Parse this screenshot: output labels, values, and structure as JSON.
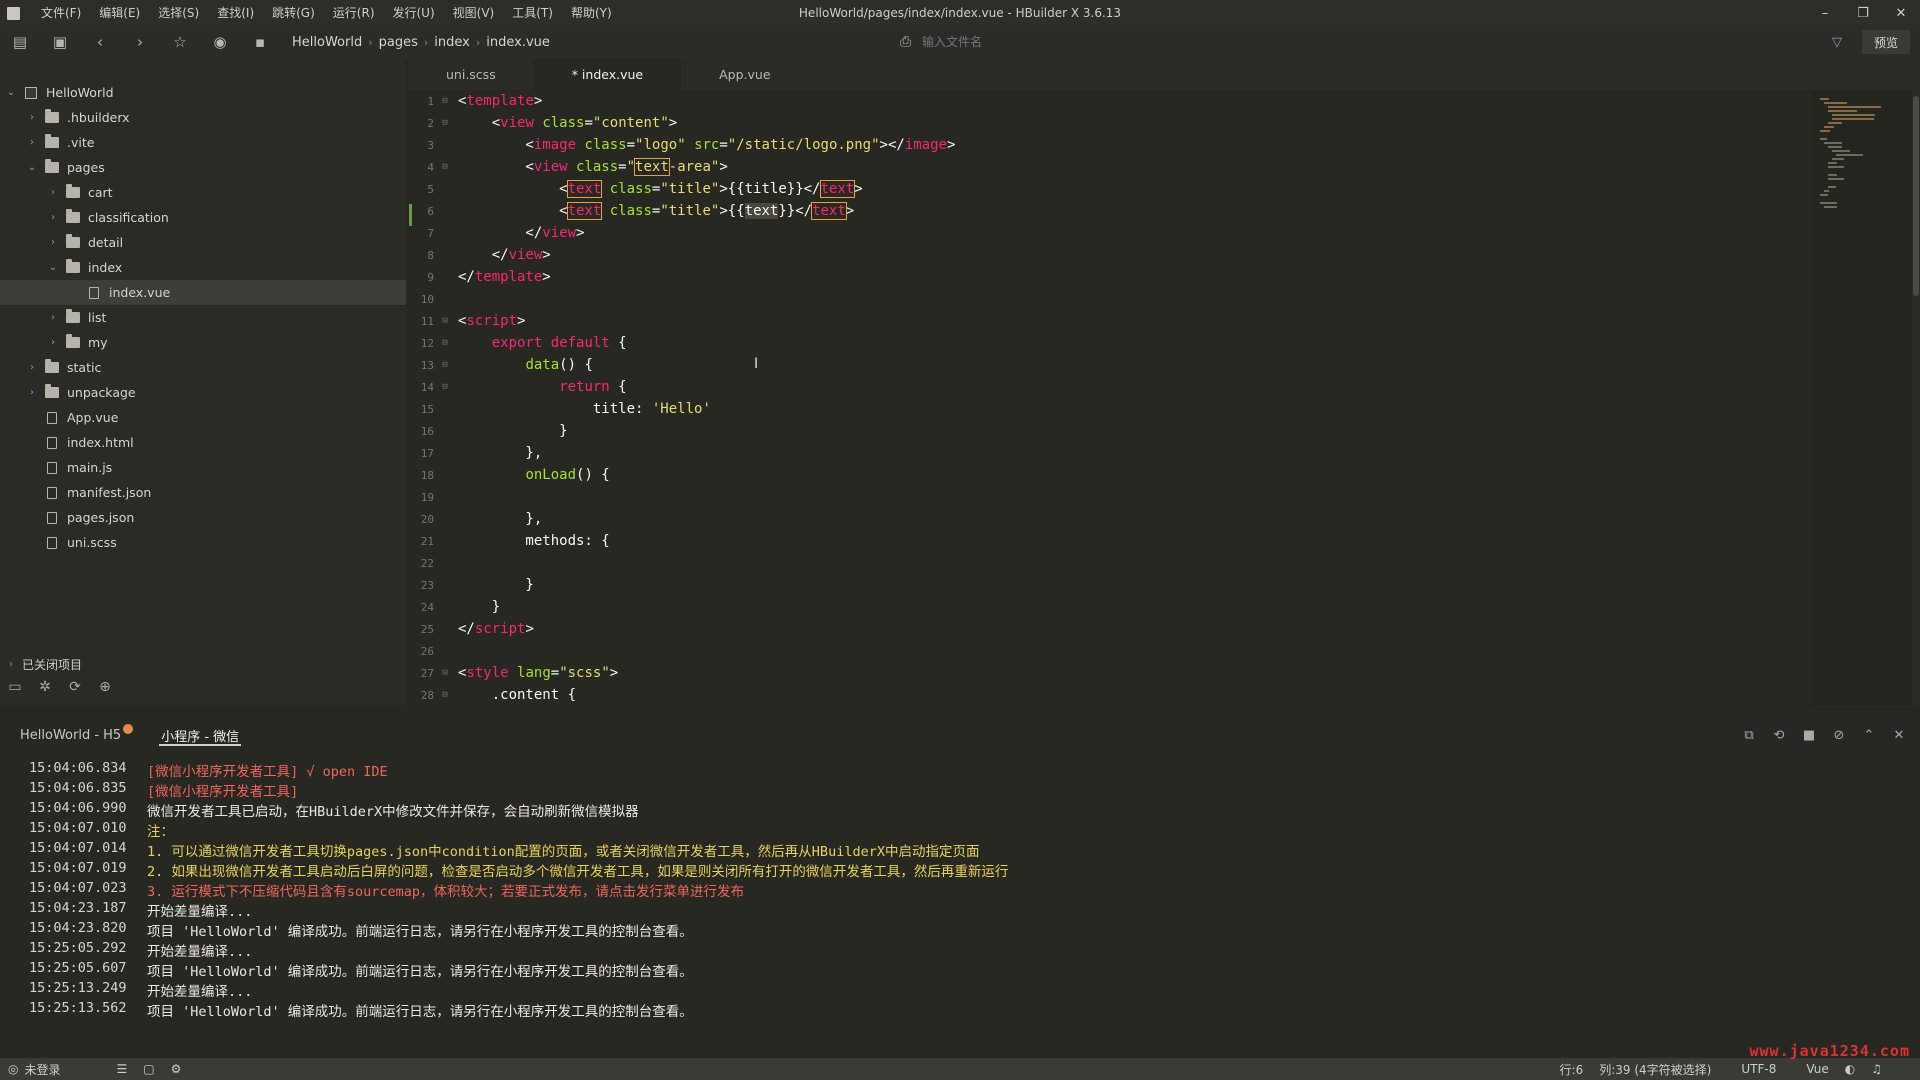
{
  "window": {
    "title": "HelloWorld/pages/index/index.vue - HBuilder X 3.6.13",
    "menus": [
      "文件(F)",
      "编辑(E)",
      "选择(S)",
      "查找(I)",
      "跳转(G)",
      "运行(R)",
      "发行(U)",
      "视图(V)",
      "工具(T)",
      "帮助(Y)"
    ],
    "controls": {
      "minimize": "–",
      "maximize": "❐",
      "close": "✕"
    }
  },
  "toolbar": {
    "breadcrumb": [
      "HelloWorld",
      "pages",
      "index",
      "index.vue"
    ],
    "file_input_placeholder": "输入文件名",
    "preview_label": "预览"
  },
  "sidebar": {
    "tree": [
      {
        "label": "HelloWorld",
        "type": "project",
        "depth": 0,
        "open": true
      },
      {
        "label": ".hbuilderx",
        "type": "folder",
        "depth": 1,
        "open": false
      },
      {
        "label": ".vite",
        "type": "folder",
        "depth": 1,
        "open": false
      },
      {
        "label": "pages",
        "type": "folder",
        "depth": 1,
        "open": true
      },
      {
        "label": "cart",
        "type": "folder",
        "depth": 2,
        "open": false
      },
      {
        "label": "classification",
        "type": "folder",
        "depth": 2,
        "open": false
      },
      {
        "label": "detail",
        "type": "folder",
        "depth": 2,
        "open": false
      },
      {
        "label": "index",
        "type": "folder",
        "depth": 2,
        "open": true
      },
      {
        "label": "index.vue",
        "type": "file",
        "depth": 3,
        "selected": true
      },
      {
        "label": "list",
        "type": "folder",
        "depth": 2,
        "open": false
      },
      {
        "label": "my",
        "type": "folder",
        "depth": 2,
        "open": false
      },
      {
        "label": "static",
        "type": "folder",
        "depth": 1,
        "open": false
      },
      {
        "label": "unpackage",
        "type": "folder",
        "depth": 1,
        "open": false
      },
      {
        "label": "App.vue",
        "type": "file",
        "depth": 1
      },
      {
        "label": "index.html",
        "type": "file",
        "depth": 1
      },
      {
        "label": "main.js",
        "type": "file",
        "depth": 1
      },
      {
        "label": "manifest.json",
        "type": "file",
        "depth": 1
      },
      {
        "label": "pages.json",
        "type": "file",
        "depth": 1
      },
      {
        "label": "uni.scss",
        "type": "file",
        "depth": 1
      }
    ],
    "closed_projects_label": "已关闭项目"
  },
  "tabs": [
    {
      "label": "uni.scss",
      "active": false
    },
    {
      "label": "* index.vue",
      "active": true
    },
    {
      "label": "App.vue",
      "active": false
    }
  ],
  "editor": {
    "lines": [
      {
        "n": "1",
        "fold": "⊟",
        "tokens": [
          [
            "t-plain",
            "<"
          ],
          [
            "t-tag",
            "template"
          ],
          [
            "t-plain",
            ">"
          ]
        ]
      },
      {
        "n": "2",
        "fold": "⊟",
        "tokens": [
          [
            "t-plain",
            "    <"
          ],
          [
            "t-tag",
            "view"
          ],
          [
            "t-plain",
            " "
          ],
          [
            "t-attr",
            "class"
          ],
          [
            "t-plain",
            "="
          ],
          [
            "t-str",
            "\"content\""
          ],
          [
            "t-plain",
            ">"
          ]
        ]
      },
      {
        "n": "3",
        "fold": "",
        "tokens": [
          [
            "t-plain",
            "        <"
          ],
          [
            "t-tag",
            "image"
          ],
          [
            "t-plain",
            " "
          ],
          [
            "t-attr",
            "class"
          ],
          [
            "t-plain",
            "="
          ],
          [
            "t-str",
            "\"logo\""
          ],
          [
            "t-plain",
            " "
          ],
          [
            "t-attr",
            "src"
          ],
          [
            "t-plain",
            "="
          ],
          [
            "t-str",
            "\"/static/logo.png\""
          ],
          [
            "t-plain",
            "></"
          ],
          [
            "t-tag",
            "image"
          ],
          [
            "t-plain",
            ">"
          ]
        ]
      },
      {
        "n": "4",
        "fold": "⊟",
        "tokens": [
          [
            "t-plain",
            "        <"
          ],
          [
            "t-tag",
            "view"
          ],
          [
            "t-plain",
            " "
          ],
          [
            "t-attr",
            "class"
          ],
          [
            "t-plain",
            "="
          ],
          [
            "t-str",
            "\""
          ],
          [
            "t-str hl",
            "text"
          ],
          [
            "t-str",
            "-area\""
          ],
          [
            "t-plain",
            ">"
          ]
        ]
      },
      {
        "n": "5",
        "fold": "",
        "tokens": [
          [
            "t-plain",
            "            <"
          ],
          [
            "t-tag hl",
            "text"
          ],
          [
            "t-plain",
            " "
          ],
          [
            "t-attr",
            "class"
          ],
          [
            "t-plain",
            "="
          ],
          [
            "t-str",
            "\"title\""
          ],
          [
            "t-plain",
            ">{{title}}</"
          ],
          [
            "t-tag hl",
            "text"
          ],
          [
            "t-plain",
            ">"
          ]
        ]
      },
      {
        "n": "6",
        "fold": "",
        "tokens": [
          [
            "t-plain",
            "            <"
          ],
          [
            "t-tag hl",
            "text"
          ],
          [
            "t-plain",
            " "
          ],
          [
            "t-attr",
            "class"
          ],
          [
            "t-plain",
            "="
          ],
          [
            "t-str",
            "\"title\""
          ],
          [
            "t-plain",
            ">{{"
          ],
          [
            "t-plain sel",
            "text"
          ],
          [
            "t-plain",
            "}}</"
          ],
          [
            "t-tag hl",
            "text"
          ],
          [
            "t-plain",
            ">"
          ]
        ]
      },
      {
        "n": "7",
        "fold": "",
        "tokens": [
          [
            "t-plain",
            "        </"
          ],
          [
            "t-tag",
            "view"
          ],
          [
            "t-plain",
            ">"
          ]
        ]
      },
      {
        "n": "8",
        "fold": "",
        "tokens": [
          [
            "t-plain",
            "    </"
          ],
          [
            "t-tag",
            "view"
          ],
          [
            "t-plain",
            ">"
          ]
        ]
      },
      {
        "n": "9",
        "fold": "",
        "tokens": [
          [
            "t-plain",
            "</"
          ],
          [
            "t-tag",
            "template"
          ],
          [
            "t-plain",
            ">"
          ]
        ]
      },
      {
        "n": "10",
        "fold": "",
        "tokens": []
      },
      {
        "n": "11",
        "fold": "⊟",
        "tokens": [
          [
            "t-plain",
            "<"
          ],
          [
            "t-tag",
            "script"
          ],
          [
            "t-plain",
            ">"
          ]
        ]
      },
      {
        "n": "12",
        "fold": "⊟",
        "tokens": [
          [
            "t-plain",
            "    "
          ],
          [
            "t-kw",
            "export"
          ],
          [
            "t-plain",
            " "
          ],
          [
            "t-kw",
            "default"
          ],
          [
            "t-plain",
            " {"
          ]
        ]
      },
      {
        "n": "13",
        "fold": "⊟",
        "tokens": [
          [
            "t-plain",
            "        "
          ],
          [
            "t-fn",
            "data"
          ],
          [
            "t-plain",
            "() {"
          ]
        ]
      },
      {
        "n": "14",
        "fold": "⊟",
        "tokens": [
          [
            "t-plain",
            "            "
          ],
          [
            "t-kw",
            "return"
          ],
          [
            "t-plain",
            " {"
          ]
        ]
      },
      {
        "n": "15",
        "fold": "",
        "tokens": [
          [
            "t-plain",
            "                title: "
          ],
          [
            "t-str",
            "'Hello'"
          ]
        ]
      },
      {
        "n": "16",
        "fold": "",
        "tokens": [
          [
            "t-plain",
            "            }"
          ]
        ]
      },
      {
        "n": "17",
        "fold": "",
        "tokens": [
          [
            "t-plain",
            "        },"
          ]
        ]
      },
      {
        "n": "18",
        "fold": "",
        "tokens": [
          [
            "t-plain",
            "        "
          ],
          [
            "t-fn",
            "onLoad"
          ],
          [
            "t-plain",
            "() {"
          ]
        ]
      },
      {
        "n": "19",
        "fold": "",
        "tokens": []
      },
      {
        "n": "20",
        "fold": "",
        "tokens": [
          [
            "t-plain",
            "        },"
          ]
        ]
      },
      {
        "n": "21",
        "fold": "",
        "tokens": [
          [
            "t-plain",
            "        methods: {"
          ]
        ]
      },
      {
        "n": "22",
        "fold": "",
        "tokens": []
      },
      {
        "n": "23",
        "fold": "",
        "tokens": [
          [
            "t-plain",
            "        }"
          ]
        ]
      },
      {
        "n": "24",
        "fold": "",
        "tokens": [
          [
            "t-plain",
            "    }"
          ]
        ]
      },
      {
        "n": "25",
        "fold": "",
        "tokens": [
          [
            "t-plain",
            "</"
          ],
          [
            "t-tag",
            "script"
          ],
          [
            "t-plain",
            ">"
          ]
        ]
      },
      {
        "n": "26",
        "fold": "",
        "tokens": []
      },
      {
        "n": "27",
        "fold": "⊟",
        "tokens": [
          [
            "t-plain",
            "<"
          ],
          [
            "t-tag",
            "style"
          ],
          [
            "t-plain",
            " "
          ],
          [
            "t-attr",
            "lang"
          ],
          [
            "t-plain",
            "="
          ],
          [
            "t-str",
            "\"scss\""
          ],
          [
            "t-plain",
            ">"
          ]
        ]
      },
      {
        "n": "28",
        "fold": "⊟",
        "tokens": [
          [
            "t-plain",
            "    .content {"
          ]
        ]
      }
    ]
  },
  "console": {
    "tabs": [
      {
        "label": "HelloWorld - H5",
        "active": false,
        "has_dot": true
      },
      {
        "label": "小程序 - 微信",
        "active": true,
        "has_dot": false
      }
    ],
    "logs": [
      {
        "time": "15:04:06.834",
        "msg": "[微信小程序开发者工具] √ open IDE",
        "color": "red"
      },
      {
        "time": "15:04:06.835",
        "msg": "[微信小程序开发者工具]",
        "color": "red"
      },
      {
        "time": "15:04:06.990",
        "msg": "微信开发者工具已启动，在HBuilderX中修改文件并保存，会自动刷新微信模拟器",
        "color": "white"
      },
      {
        "time": "15:04:07.010",
        "msg": "注：",
        "color": "yellow"
      },
      {
        "time": "15:04:07.014",
        "msg": "1. 可以通过微信开发者工具切换pages.json中condition配置的页面，或者关闭微信开发者工具，然后再从HBuilderX中启动指定页面",
        "color": "yellow"
      },
      {
        "time": "15:04:07.019",
        "msg": "2. 如果出现微信开发者工具启动后白屏的问题，检查是否启动多个微信开发者工具，如果是则关闭所有打开的微信开发者工具，然后再重新运行",
        "color": "yellow"
      },
      {
        "time": "15:04:07.023",
        "msg": "3. 运行模式下不压缩代码且含有sourcemap，体积较大；若要正式发布，请点击发行菜单进行发布",
        "color": "red"
      },
      {
        "time": "15:04:23.187",
        "msg": "开始差量编译...",
        "color": "white"
      },
      {
        "time": "15:04:23.820",
        "msg": "项目 'HelloWorld' 编译成功。前端运行日志，请另行在小程序开发工具的控制台查看。",
        "color": "white"
      },
      {
        "time": "15:25:05.292",
        "msg": "开始差量编译...",
        "color": "white"
      },
      {
        "time": "15:25:05.607",
        "msg": "项目 'HelloWorld' 编译成功。前端运行日志，请另行在小程序开发工具的控制台查看。",
        "color": "white"
      },
      {
        "time": "15:25:13.249",
        "msg": "开始差量编译...",
        "color": "white"
      },
      {
        "time": "15:25:13.562",
        "msg": "项目 'HelloWorld' 编译成功。前端运行日志，请另行在小程序开发工具的控制台查看。",
        "color": "white"
      }
    ]
  },
  "statusbar": {
    "login": "未登录",
    "row": "行:6",
    "col": "列:39 (4字符被选择)",
    "encoding": "UTF-8",
    "language": "Vue",
    "watermark": "www.java1234.com"
  }
}
